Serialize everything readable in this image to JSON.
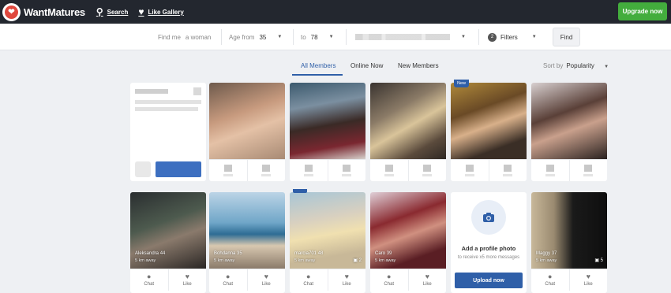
{
  "header": {
    "logo_text": "WantMatures",
    "nav": [
      {
        "label": "Search",
        "icon": "search-icon"
      },
      {
        "label": "Like Gallery",
        "icon": "heart-icon"
      }
    ],
    "upgrade_label": "Upgrade now"
  },
  "filters": {
    "find_me_label": "Find me",
    "find_me_value": "a woman",
    "age_from_label": "Age from",
    "age_from_value": "35",
    "age_to_label": "to",
    "age_to_value": "78",
    "filters_count": "2",
    "filters_label": "Filters",
    "find_button": "Find"
  },
  "tabs": [
    {
      "label": "All Members",
      "active": true
    },
    {
      "label": "Online Now",
      "active": false
    },
    {
      "label": "New Members",
      "active": false
    }
  ],
  "sort": {
    "label": "Sort by",
    "value": "Popularity"
  },
  "row2": [
    {
      "name": "Aleksandra",
      "age": "44",
      "distance": "5 km away",
      "photos": "",
      "chat": "Chat",
      "like": "Like"
    },
    {
      "name": "Bohdanna",
      "age": "35",
      "distance": "5 km away",
      "photos": "",
      "chat": "Chat",
      "like": "Like"
    },
    {
      "name": "marcia701",
      "age": "48",
      "distance": "5 km away",
      "photos": "2",
      "chat": "Chat",
      "like": "Like"
    },
    {
      "name": "Caro",
      "age": "39",
      "distance": "5 km away",
      "photos": "",
      "chat": "Chat",
      "like": "Like"
    },
    {
      "name": "Maggy",
      "age": "37",
      "distance": "5 km away",
      "photos": "5",
      "chat": "Chat",
      "like": "Like"
    }
  ],
  "new_badge": "New",
  "profile_prompt": {
    "title": "Add a profile photo",
    "subtitle": "to receive x5 more messages",
    "button": "Upload now"
  },
  "colors": {
    "accent": "#2f5fa8",
    "upgrade": "#43ad3d",
    "topbar": "#23272f"
  }
}
